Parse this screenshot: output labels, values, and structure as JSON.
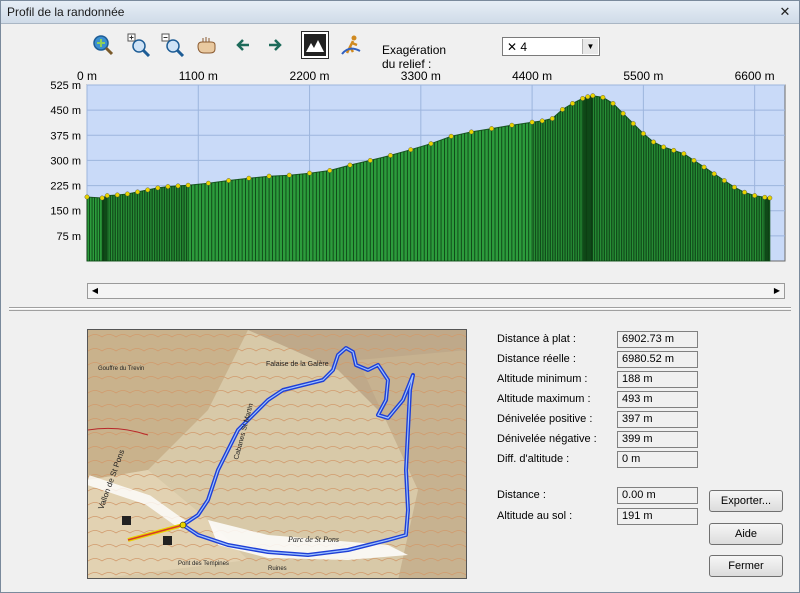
{
  "window": {
    "title": "Profil de la randonnée",
    "close_glyph": "✕"
  },
  "toolbar": {
    "buttons": [
      {
        "icon": "zoom-fit-icon"
      },
      {
        "icon": "zoom-in-icon"
      },
      {
        "icon": "zoom-out-icon"
      },
      {
        "icon": "pan-hand-icon"
      },
      {
        "icon": "arrow-left-icon"
      },
      {
        "icon": "arrow-right-icon"
      },
      {
        "icon": "relief-mountain-icon"
      },
      {
        "icon": "walker-icon"
      }
    ],
    "relief_label": "Exagération du relief :",
    "relief_value": "✕ 4"
  },
  "chart_data": {
    "type": "area",
    "x_unit": "m",
    "y_unit": "m",
    "x_ticks": [
      "0 m",
      "1100 m",
      "2200 m",
      "3300 m",
      "4400 m",
      "5500 m",
      "6600 m"
    ],
    "y_ticks": [
      "525 m",
      "450 m",
      "375 m",
      "300 m",
      "225 m",
      "150 m",
      "75 m"
    ],
    "xlim": [
      0,
      6900
    ],
    "ylim": [
      0,
      525
    ],
    "x": [
      0,
      150,
      200,
      300,
      400,
      500,
      600,
      700,
      800,
      900,
      1000,
      1200,
      1400,
      1600,
      1800,
      2000,
      2200,
      2400,
      2600,
      2800,
      3000,
      3200,
      3400,
      3600,
      3800,
      4000,
      4200,
      4400,
      4500,
      4600,
      4700,
      4800,
      4900,
      4950,
      5000,
      5100,
      5200,
      5300,
      5400,
      5500,
      5600,
      5700,
      5800,
      5900,
      6000,
      6100,
      6200,
      6300,
      6400,
      6500,
      6600,
      6700,
      6750
    ],
    "y": [
      191,
      188,
      195,
      197,
      200,
      206,
      212,
      218,
      222,
      224,
      226,
      232,
      240,
      247,
      253,
      256,
      262,
      270,
      286,
      300,
      315,
      332,
      350,
      372,
      385,
      395,
      405,
      414,
      418,
      425,
      452,
      470,
      485,
      490,
      493,
      488,
      470,
      440,
      410,
      380,
      355,
      340,
      330,
      320,
      300,
      280,
      260,
      240,
      220,
      205,
      195,
      190,
      188
    ],
    "grid": true,
    "fill_color": "#2c9c3c",
    "line_color": "#e8d400",
    "plot_bg": "#c9daf8"
  },
  "stats": [
    {
      "label": "Distance à plat :",
      "value": "6902.73 m"
    },
    {
      "label": "Distance réelle :",
      "value": "6980.52 m"
    },
    {
      "label": "Altitude minimum :",
      "value": "188 m"
    },
    {
      "label": "Altitude maximum :",
      "value": "493 m"
    },
    {
      "label": "Dénivelée positive :",
      "value": "397 m"
    },
    {
      "label": "Dénivelée négative :",
      "value": "399 m"
    },
    {
      "label": "Diff. d'altitude :",
      "value": "0 m"
    }
  ],
  "cursor": [
    {
      "label": "Distance :",
      "value": "0.00 m"
    },
    {
      "label": "Altitude au sol :",
      "value": "191 m"
    }
  ],
  "buttons": {
    "export": "Exporter...",
    "help": "Aide",
    "close": "Fermer"
  },
  "map": {
    "labels": [
      "Falaise de la Galère",
      "Parc de St Pons",
      "Cabanes St Martin",
      "Pont des Tempines",
      "Ruines",
      "Vallon de St Pons",
      "Gouffre du Trevin"
    ],
    "route_color": "#1e3fd6"
  },
  "colors": {
    "accent": "#2c9c3c",
    "track": "#1e3fd6"
  }
}
